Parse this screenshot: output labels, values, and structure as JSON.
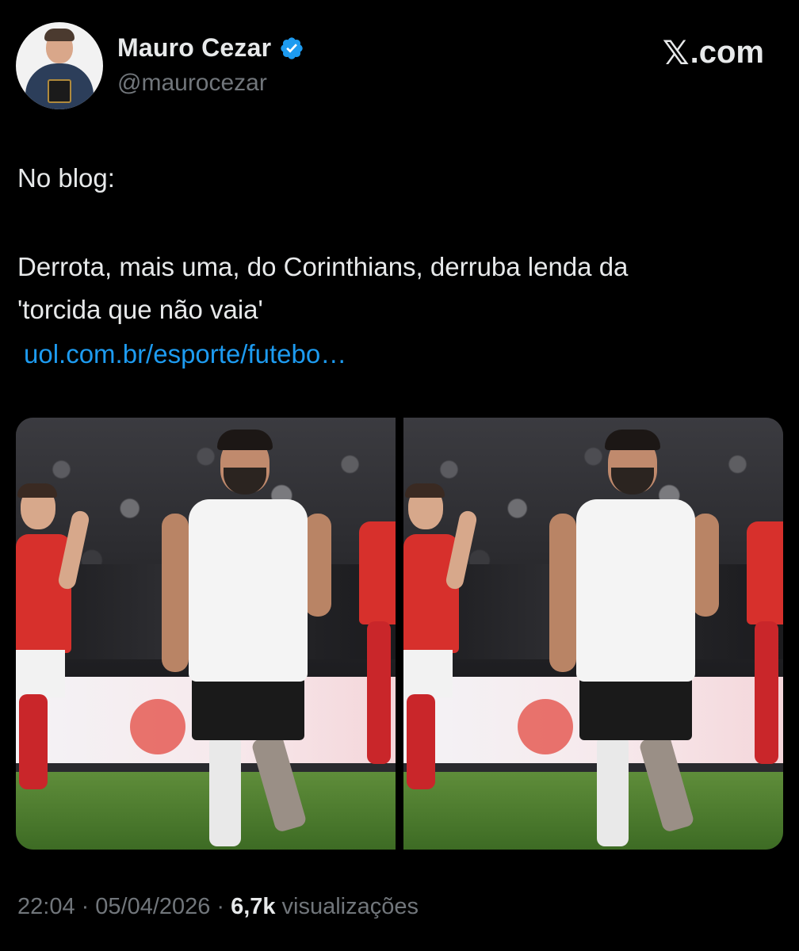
{
  "author": {
    "name": "Mauro Cezar",
    "handle": "@maurocezar",
    "verified": true,
    "avatar_icon": "profile-photo"
  },
  "brand": {
    "x_glyph": "𝕏",
    "suffix": ".com"
  },
  "post": {
    "line1": "No blog:",
    "line2": "Derrota, mais uma, do Corinthians, derruba lenda da",
    "line3": "'torcida que não vaia'",
    "link": "uol.com.br/esporte/futebo…"
  },
  "media": {
    "count": 2
  },
  "footer": {
    "time": "22:04",
    "separator1": "·",
    "date": "05/04/2026",
    "separator2": "·",
    "views_count": "6,7k",
    "views_label": "visualizações"
  },
  "colors": {
    "background": "#000000",
    "text": "#e7e9ea",
    "muted": "#71767b",
    "link": "#1d9bf0",
    "verified": "#1d9bf0"
  }
}
